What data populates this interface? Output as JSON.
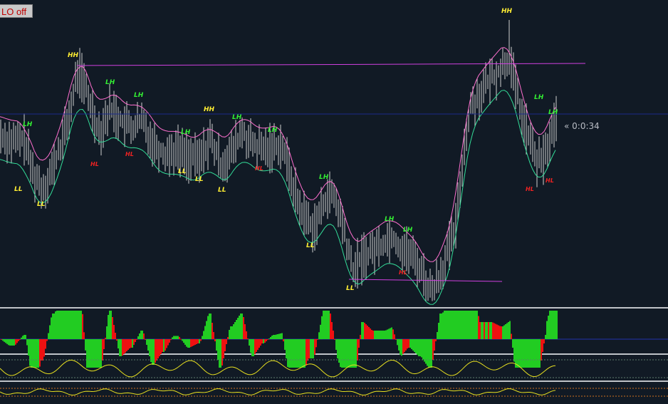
{
  "toolbar": {
    "lo_button_label": "LO off"
  },
  "countdown": "« 0:0:34",
  "colors": {
    "background": "#111a25",
    "price_bars": "#d0d0d0",
    "upper_envelope": "#ff6fcf",
    "lower_envelope": "#33dd99",
    "level_line": "#d040e0",
    "current_price_line": "#1c2a8c",
    "label_hh": "#ffee33",
    "label_ll": "#ffee33",
    "label_lh": "#33ee33",
    "label_hl": "#ee2222",
    "hist_up": "#ee1111",
    "hist_down": "#22cc22",
    "oscillator": "#e8e020"
  },
  "chart_data": {
    "type": "candlestick",
    "price_labels": [
      {
        "text": "HH",
        "color": "hh"
      },
      {
        "text": "HH",
        "color": "hh"
      },
      {
        "text": "HH",
        "color": "hh"
      },
      {
        "text": "LH",
        "color": "lh"
      },
      {
        "text": "LH",
        "color": "lh"
      },
      {
        "text": "LH",
        "color": "lh"
      },
      {
        "text": "LH",
        "color": "lh"
      },
      {
        "text": "LH",
        "color": "lh"
      },
      {
        "text": "LH",
        "color": "lh"
      },
      {
        "text": "LH",
        "color": "lh"
      },
      {
        "text": "LH",
        "color": "lh"
      },
      {
        "text": "LH",
        "color": "lh"
      },
      {
        "text": "LH",
        "color": "lh"
      },
      {
        "text": "LH",
        "color": "lh"
      },
      {
        "text": "HL",
        "color": "hl"
      },
      {
        "text": "HL",
        "color": "hl"
      },
      {
        "text": "HL",
        "color": "hl"
      },
      {
        "text": "HL",
        "color": "hl"
      },
      {
        "text": "HL",
        "color": "hl"
      },
      {
        "text": "HL",
        "color": "hl"
      },
      {
        "text": "LL",
        "color": "ll"
      },
      {
        "text": "LL",
        "color": "ll"
      },
      {
        "text": "LL",
        "color": "ll"
      },
      {
        "text": "LL",
        "color": "ll"
      },
      {
        "text": "LL",
        "color": "ll"
      },
      {
        "text": "LL",
        "color": "ll"
      },
      {
        "text": "LL",
        "color": "ll"
      }
    ]
  }
}
